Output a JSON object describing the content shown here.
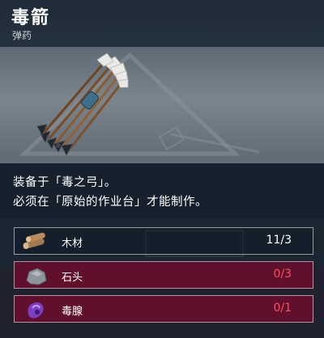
{
  "item": {
    "name": "毒箭",
    "category": "弹药",
    "icon": "poison-arrow-bundle-icon"
  },
  "description": {
    "line1": "装备于「毒之弓」。",
    "line2": "必须在「原始的作业台」才能制作。"
  },
  "materials": [
    {
      "name": "木材",
      "count": "11/3",
      "icon": "wood-logs-icon",
      "sufficient": true
    },
    {
      "name": "石头",
      "count": "0/3",
      "icon": "stone-icon",
      "sufficient": false
    },
    {
      "name": "毒腺",
      "count": "0/1",
      "icon": "poison-gland-icon",
      "sufficient": false
    }
  ],
  "colors": {
    "insufficient_count": "#ff4d5a",
    "insufficient_row": "#78102d",
    "header_bg": "#1f2b37"
  }
}
